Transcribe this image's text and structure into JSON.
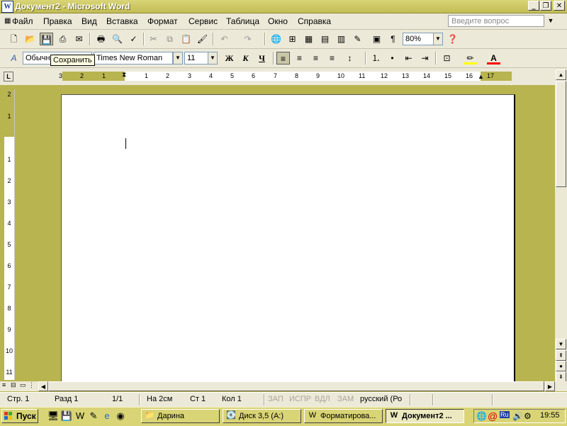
{
  "window": {
    "title": "Документ2 - Microsoft Word",
    "app_icon": "W"
  },
  "menu": [
    "Файл",
    "Правка",
    "Вид",
    "Вставка",
    "Формат",
    "Сервис",
    "Таблица",
    "Окно",
    "Справка"
  ],
  "ask_box": {
    "placeholder": "Введите вопрос"
  },
  "toolbar": {
    "zoom": "80%"
  },
  "format_bar": {
    "style": "Обычный",
    "font": "Times New Roman",
    "size": "11",
    "bold": "Ж",
    "italic": "К",
    "underline": "Ч",
    "font_color_letter": "A"
  },
  "tooltip": {
    "text": "Сохранить"
  },
  "ruler": {
    "h_labels": [
      "3",
      "2",
      "1",
      "1",
      "2",
      "3",
      "4",
      "5",
      "6",
      "7",
      "8",
      "9",
      "10",
      "11",
      "12",
      "13",
      "14",
      "15",
      "16",
      "17"
    ],
    "v_labels": [
      "2",
      "1",
      "1",
      "2",
      "3",
      "4",
      "5",
      "6",
      "7",
      "8",
      "9",
      "10",
      "11"
    ]
  },
  "status": {
    "page": "Стр. 1",
    "section": "Разд 1",
    "pages": "1/1",
    "at": "На 2см",
    "line": "Ст 1",
    "col": "Кол 1",
    "rec": "ЗАП",
    "trk": "ИСПР",
    "ext": "ВДЛ",
    "ovr": "ЗАМ",
    "lang": "русский (Ро"
  },
  "taskbar": {
    "start": "Пуск",
    "tasks": [
      "Дарина",
      "Диск 3,5 (A:)",
      "Форматирова...",
      "Документ2 ..."
    ],
    "clock": "19:55"
  }
}
